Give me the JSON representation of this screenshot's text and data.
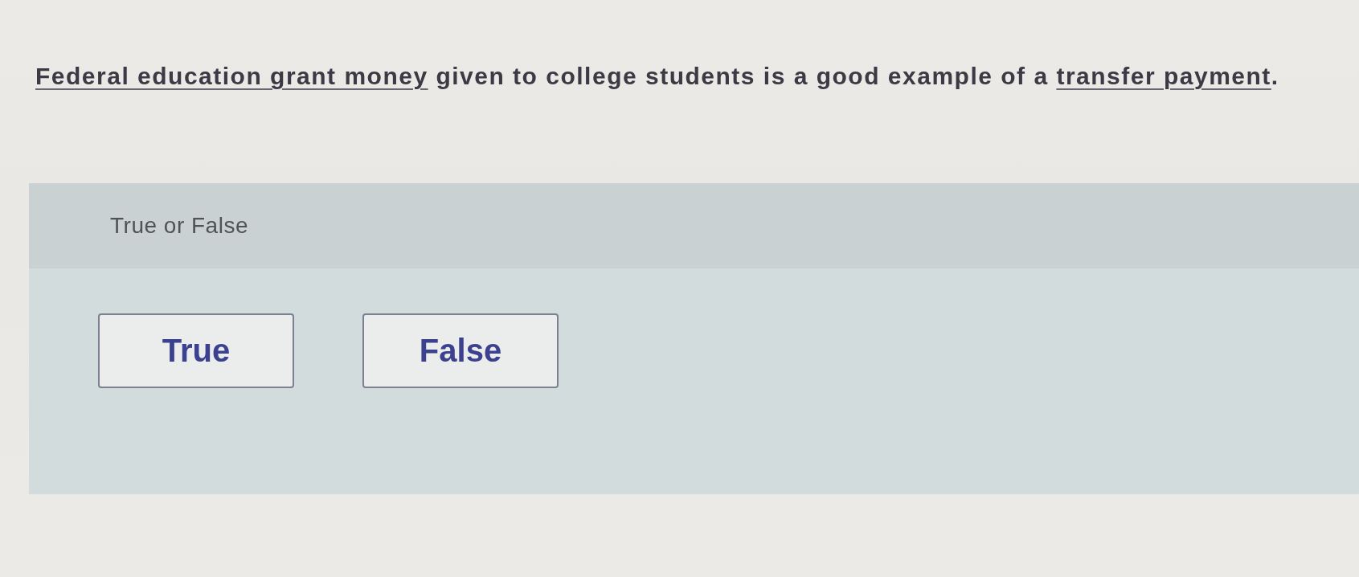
{
  "question": {
    "segments": [
      {
        "kind": "link",
        "text": "Federal education grant money"
      },
      {
        "kind": "plain",
        "text": " given to college students is a good example of a "
      },
      {
        "kind": "link",
        "text": "transfer payment"
      },
      {
        "kind": "plain",
        "text": "."
      }
    ]
  },
  "answer_panel": {
    "prompt": "True or False",
    "options": [
      {
        "label": "True",
        "selected": false
      },
      {
        "label": "False",
        "selected": false
      }
    ]
  }
}
